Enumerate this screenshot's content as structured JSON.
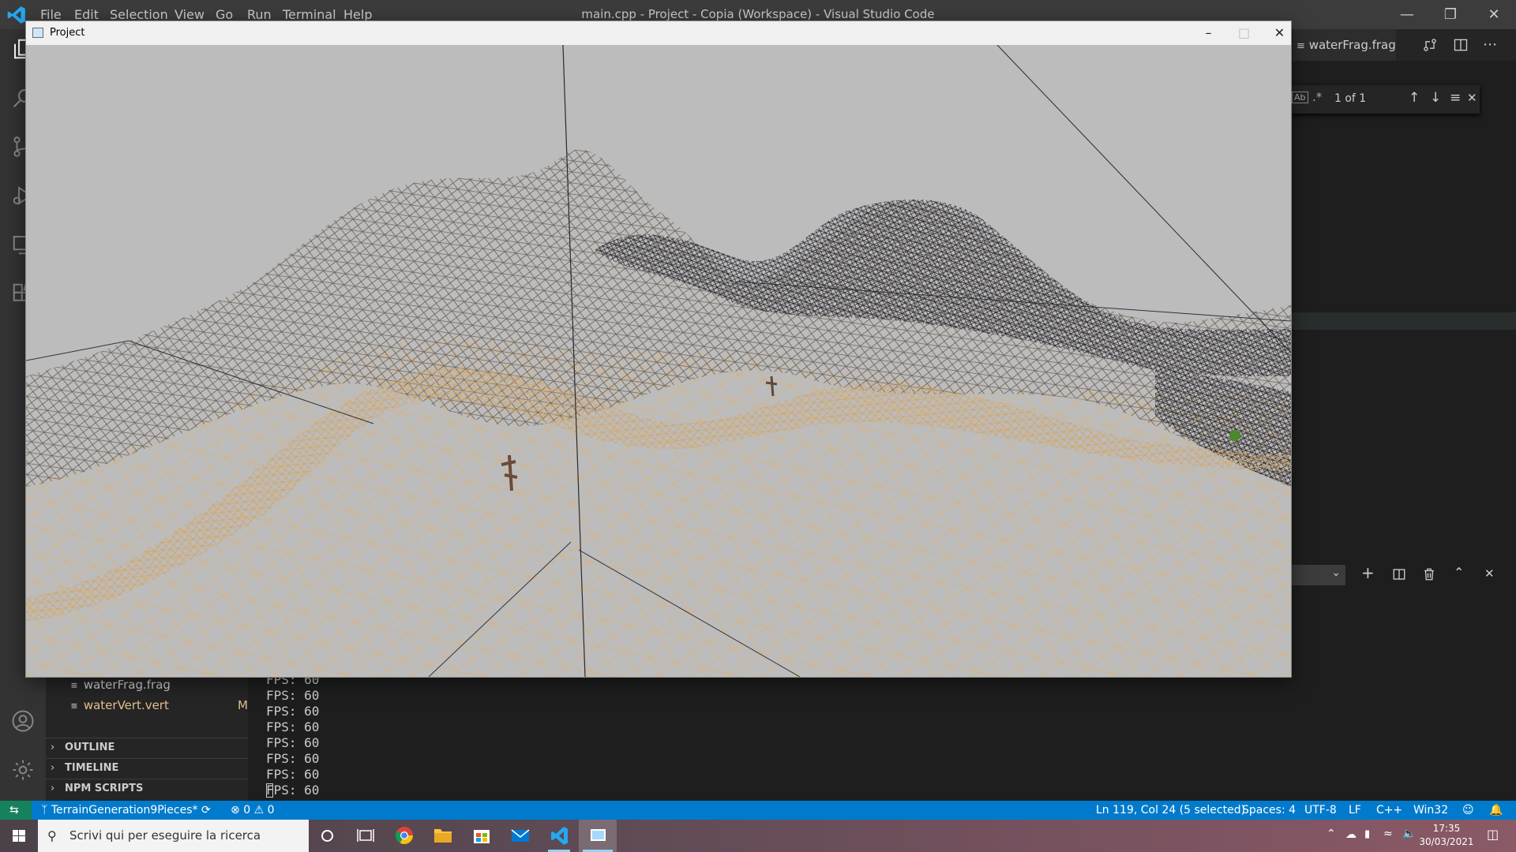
{
  "titlebar": {
    "menu": [
      "File",
      "Edit",
      "Selection",
      "View",
      "Go",
      "Run",
      "Terminal",
      "Help"
    ],
    "title": "main.cpp - Project - Copia (Workspace) - Visual Studio Code"
  },
  "project_window": {
    "title": "Project"
  },
  "editor": {
    "tab_label": "waterFrag.frag",
    "find_result": "1 of 1"
  },
  "sidebar": {
    "files": [
      {
        "name": "waterFrag.frag",
        "badge": ""
      },
      {
        "name": "waterVert.vert",
        "badge": "M"
      }
    ],
    "sections": [
      "OUTLINE",
      "TIMELINE",
      "NPM SCRIPTS"
    ]
  },
  "terminal": {
    "lines": [
      "FPS: 60",
      "FPS: 60",
      "FPS: 60",
      "FPS: 60",
      "FPS: 60",
      "FPS: 60",
      "FPS: 60",
      "FPS: 60"
    ]
  },
  "statusbar": {
    "branch": "TerrainGeneration9Pieces*",
    "errors": "0",
    "warnings": "0",
    "cursor": "Ln 119, Col 24 (5 selected)",
    "spaces": "Spaces: 4",
    "encoding": "UTF-8",
    "eol": "LF",
    "language": "C++",
    "platform": "Win32"
  },
  "taskbar": {
    "search_placeholder": "Scrivi qui per eseguire la ricerca",
    "time": "17:35",
    "date": "30/03/2021"
  },
  "colors": {
    "vscode_blue": "#007acc",
    "mesh_dark": "#20202a",
    "mesh_sand": "#d9b98a"
  }
}
